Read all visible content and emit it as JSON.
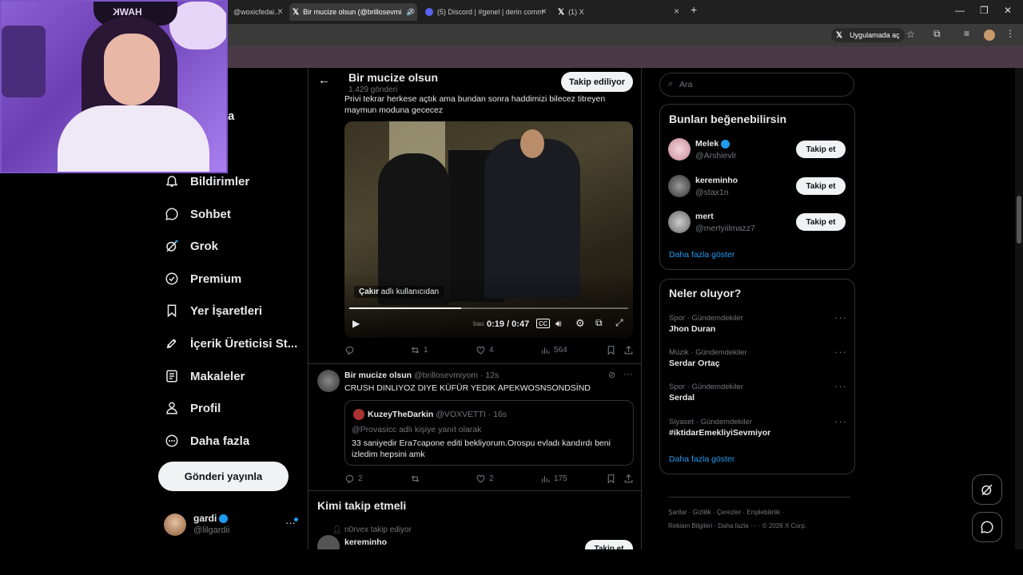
{
  "browser": {
    "tabs": [
      {
        "label": "@woxicfedai..."
      },
      {
        "label": "Bir mucize olsun (@brillosevmi"
      },
      {
        "label": "(5) Discord | #genel | derin comm"
      },
      {
        "label": "(1) X"
      }
    ],
    "app_button": "Uygulamada aç"
  },
  "webcam": {
    "hat_text": "HAWK"
  },
  "sidebar": {
    "partial_label": "fa",
    "items": [
      {
        "label": "Bildirimler"
      },
      {
        "label": "Sohbet"
      },
      {
        "label": "Grok"
      },
      {
        "label": "Premium"
      },
      {
        "label": "Yer İşaretleri"
      },
      {
        "label": "İçerik Üreticisi St..."
      },
      {
        "label": "Makaleler"
      },
      {
        "label": "Profil"
      },
      {
        "label": "Daha fazla"
      }
    ],
    "post_button": "Gönderi yayınla",
    "account": {
      "name": "gardi",
      "handle": "@lilgardii"
    }
  },
  "main": {
    "header": {
      "title": "Bir mucize olsun",
      "subtitle": "1.429 gönderi",
      "follow_label": "Takip ediliyor"
    },
    "tweet1": {
      "text_line1": "Privi tekrar herkese açtık ama bundan sonra haddimizi bilecez titreyen",
      "text_line2": "maymun moduna gececez",
      "video": {
        "source_label": "Çakır",
        "source_suffix": "adlı kullanıcıdan",
        "time": "0:19 / 0:47",
        "progress": 0.4,
        "watermark": "bao"
      },
      "stats": {
        "replies": "",
        "reposts": "1",
        "likes": "4",
        "views": "564"
      }
    },
    "tweet2": {
      "author": "Bir mucize olsun",
      "handle": "@brillosevmiyom",
      "time": "· 12s",
      "text": "CRUSH DINLIYOZ DIYE KÜFÜR YEDIK APEKWOSNSONDSİND",
      "quote": {
        "author": "KuzeyTheDarkin",
        "handle": "@VOXVETTI",
        "time": "· 16s",
        "reply_to": "@Provasicc adlı kişiye yanıt olarak",
        "text_line1": "33 saniyedir Era7capone editi bekliyorum.Orospu evladı kandırdı beni",
        "text_line2": "izledim hepsini amk"
      },
      "stats": {
        "replies": "2",
        "reposts": "",
        "likes": "2",
        "views": "175"
      }
    },
    "who_to_follow": {
      "title": "Kimi takip etmeli",
      "context": "n0rvex takip ediyor",
      "user": "kereminho",
      "button": "Takip et"
    }
  },
  "right": {
    "search_placeholder": "Ara",
    "suggestions": {
      "title": "Bunları beğenebilirsin",
      "users": [
        {
          "name": "Melek",
          "handle": "@Arshievlr",
          "button": "Takip et"
        },
        {
          "name": "kereminho",
          "handle": "@stax1n",
          "button": "Takip et"
        },
        {
          "name": "mert",
          "handle": "@mertyiilmazz7",
          "button": "Takip et"
        }
      ],
      "show_more": "Daha fazla göster"
    },
    "trends": {
      "title": "Neler oluyor?",
      "items": [
        {
          "category": "Spor · Gündemdekiler",
          "name": "Jhon Duran"
        },
        {
          "category": "Müzik · Gündemdekiler",
          "name": "Serdar Ortaç"
        },
        {
          "category": "Spor · Gündemdekiler",
          "name": "Serdal"
        },
        {
          "category": "Siyaset · Gündemdekiler",
          "name": "#iktidarEmekliyiSevmiyor"
        }
      ],
      "show_more": "Daha fazla göster"
    },
    "footer": {
      "line1": [
        "Şartlar",
        "Gizlilik",
        "Çerezler",
        "Erişilebilirlik"
      ],
      "line2": [
        "Reklam Bilgileri",
        "Daha fazla ···",
        "© 2026 X Corp."
      ]
    }
  },
  "colors": {
    "accent": "#1d9bf0",
    "background": "#000000",
    "border": "#2f3336",
    "muted": "#71767b"
  }
}
